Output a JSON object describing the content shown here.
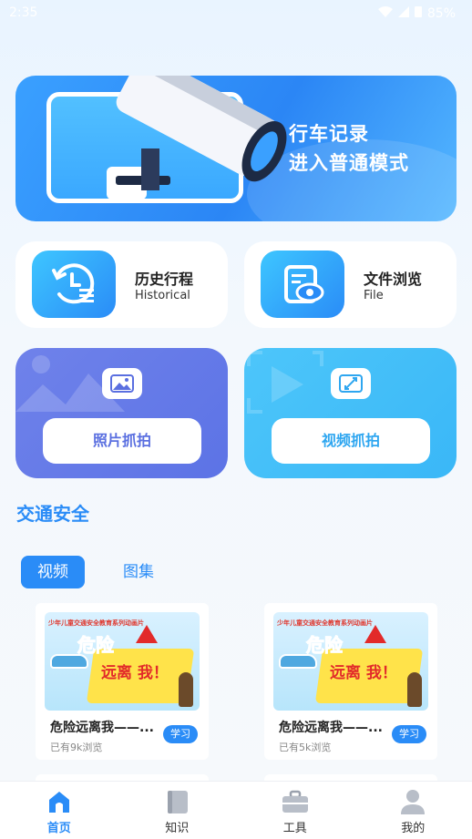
{
  "status_bar": {
    "time": "2:35",
    "battery": "85%"
  },
  "banner": {
    "line1": "行车记录",
    "line2": "进入普通模式"
  },
  "features": [
    {
      "title": "历史行程",
      "subtitle": "Historical"
    },
    {
      "title": "文件浏览",
      "subtitle": "File"
    }
  ],
  "capture": {
    "photo_label": "照片抓拍",
    "video_label": "视频抓拍"
  },
  "section": {
    "title": "交通安全"
  },
  "tabs": [
    {
      "label": "视频"
    },
    {
      "label": "图集"
    }
  ],
  "videos": [
    {
      "thumb_top": "少年儿童交通安全教育系列动画片",
      "thumb_big1": "危险",
      "thumb_big2": "远离 我！",
      "title": "危险远离我——...",
      "views": "已有9k浏览",
      "badge": "学习"
    },
    {
      "thumb_top": "少年儿童交通安全教育系列动画片",
      "thumb_big1": "危险",
      "thumb_big2": "远离 我！",
      "title": "危险远离我——...",
      "views": "已有5k浏览",
      "badge": "学习"
    }
  ],
  "nav": [
    {
      "label": "首页"
    },
    {
      "label": "知识"
    },
    {
      "label": "工具"
    },
    {
      "label": "我的"
    }
  ],
  "colors": {
    "accent": "#2a8cf7",
    "photo": "#5c73e6",
    "video": "#3ab7f7"
  }
}
